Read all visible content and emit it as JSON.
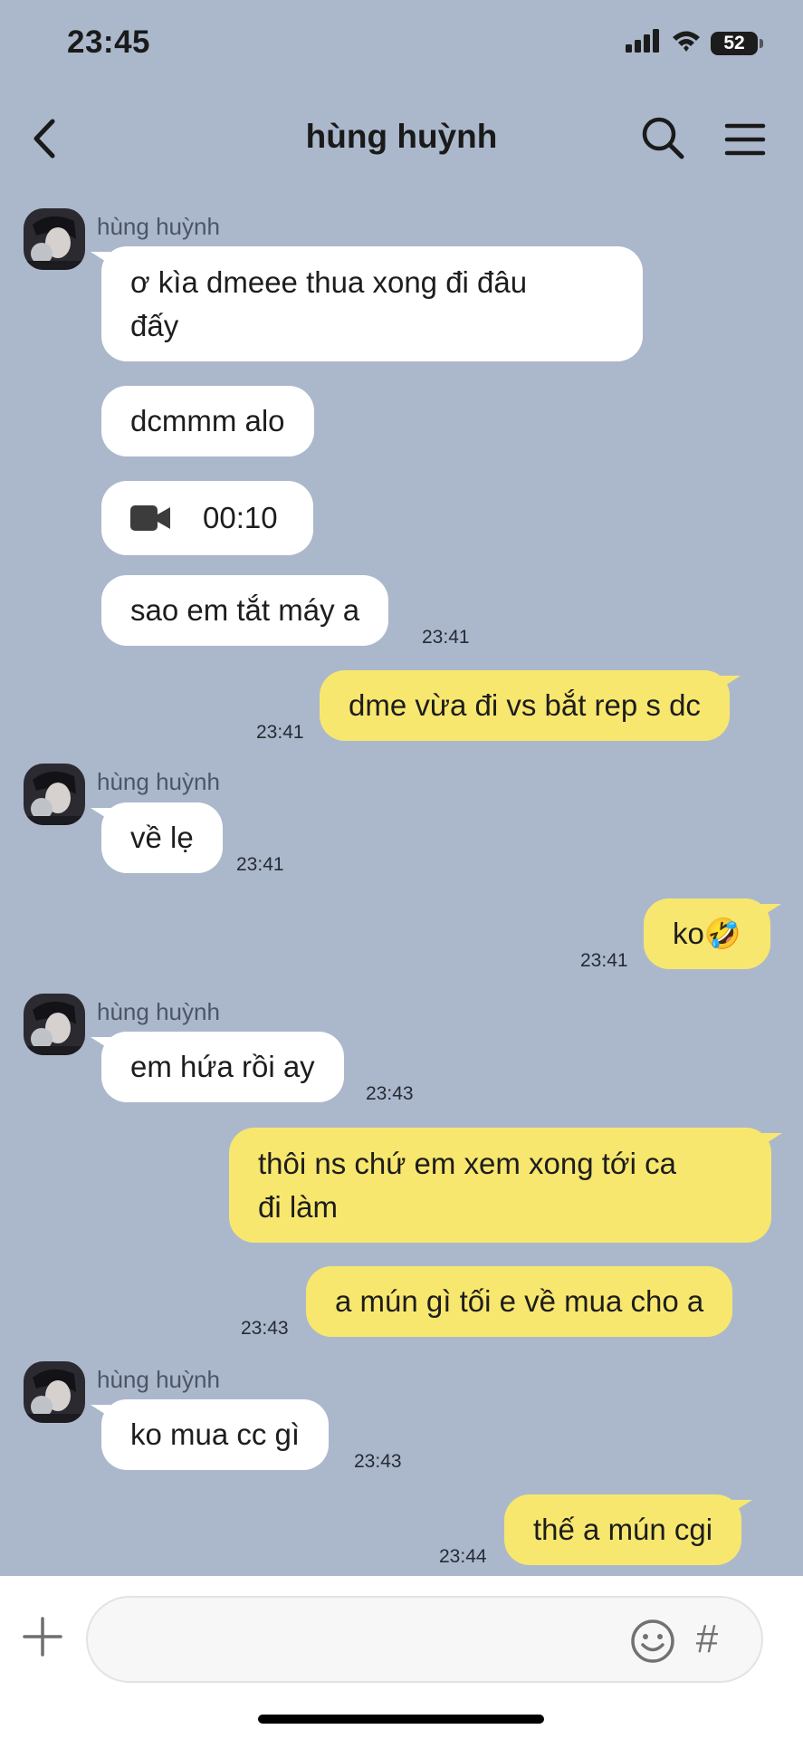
{
  "status": {
    "time": "23:45",
    "battery": "52"
  },
  "header": {
    "title": "hùng huỳnh"
  },
  "messages": [
    {
      "sender": "hùng huỳnh",
      "text": "ơ kìa dmeee thua xong đi đâu",
      "text2": "đấy"
    },
    {
      "text": "dcmmm alo"
    },
    {
      "duration": "00:10"
    },
    {
      "text": "sao em tắt máy a",
      "time": "23:41"
    },
    {
      "text": "dme vừa đi vs bắt rep s dc",
      "time": "23:41"
    },
    {
      "sender": "hùng huỳnh",
      "text": "về lẹ",
      "time": "23:41"
    },
    {
      "text": "ko🤣",
      "time": "23:41"
    },
    {
      "sender": "hùng huỳnh",
      "text": "em hứa rồi ay",
      "time": "23:43"
    },
    {
      "text": "thôi ns chứ em xem xong tới ca",
      "text2": "đi làm"
    },
    {
      "text": "a mún gì tối e về mua cho a",
      "time": "23:43"
    },
    {
      "sender": "hùng huỳnh",
      "text": "ko mua cc gì",
      "time": "23:43"
    },
    {
      "text": "thế a mún cgi",
      "time": "23:44"
    }
  ],
  "composer": {
    "placeholder": ""
  },
  "colors": {
    "background": "#abb8cc",
    "incoming_bubble": "#ffffff",
    "outgoing_bubble": "#f8e76e"
  },
  "icons": [
    "back-arrow",
    "search",
    "menu",
    "video-camera",
    "plus",
    "emoji",
    "hashtag"
  ]
}
